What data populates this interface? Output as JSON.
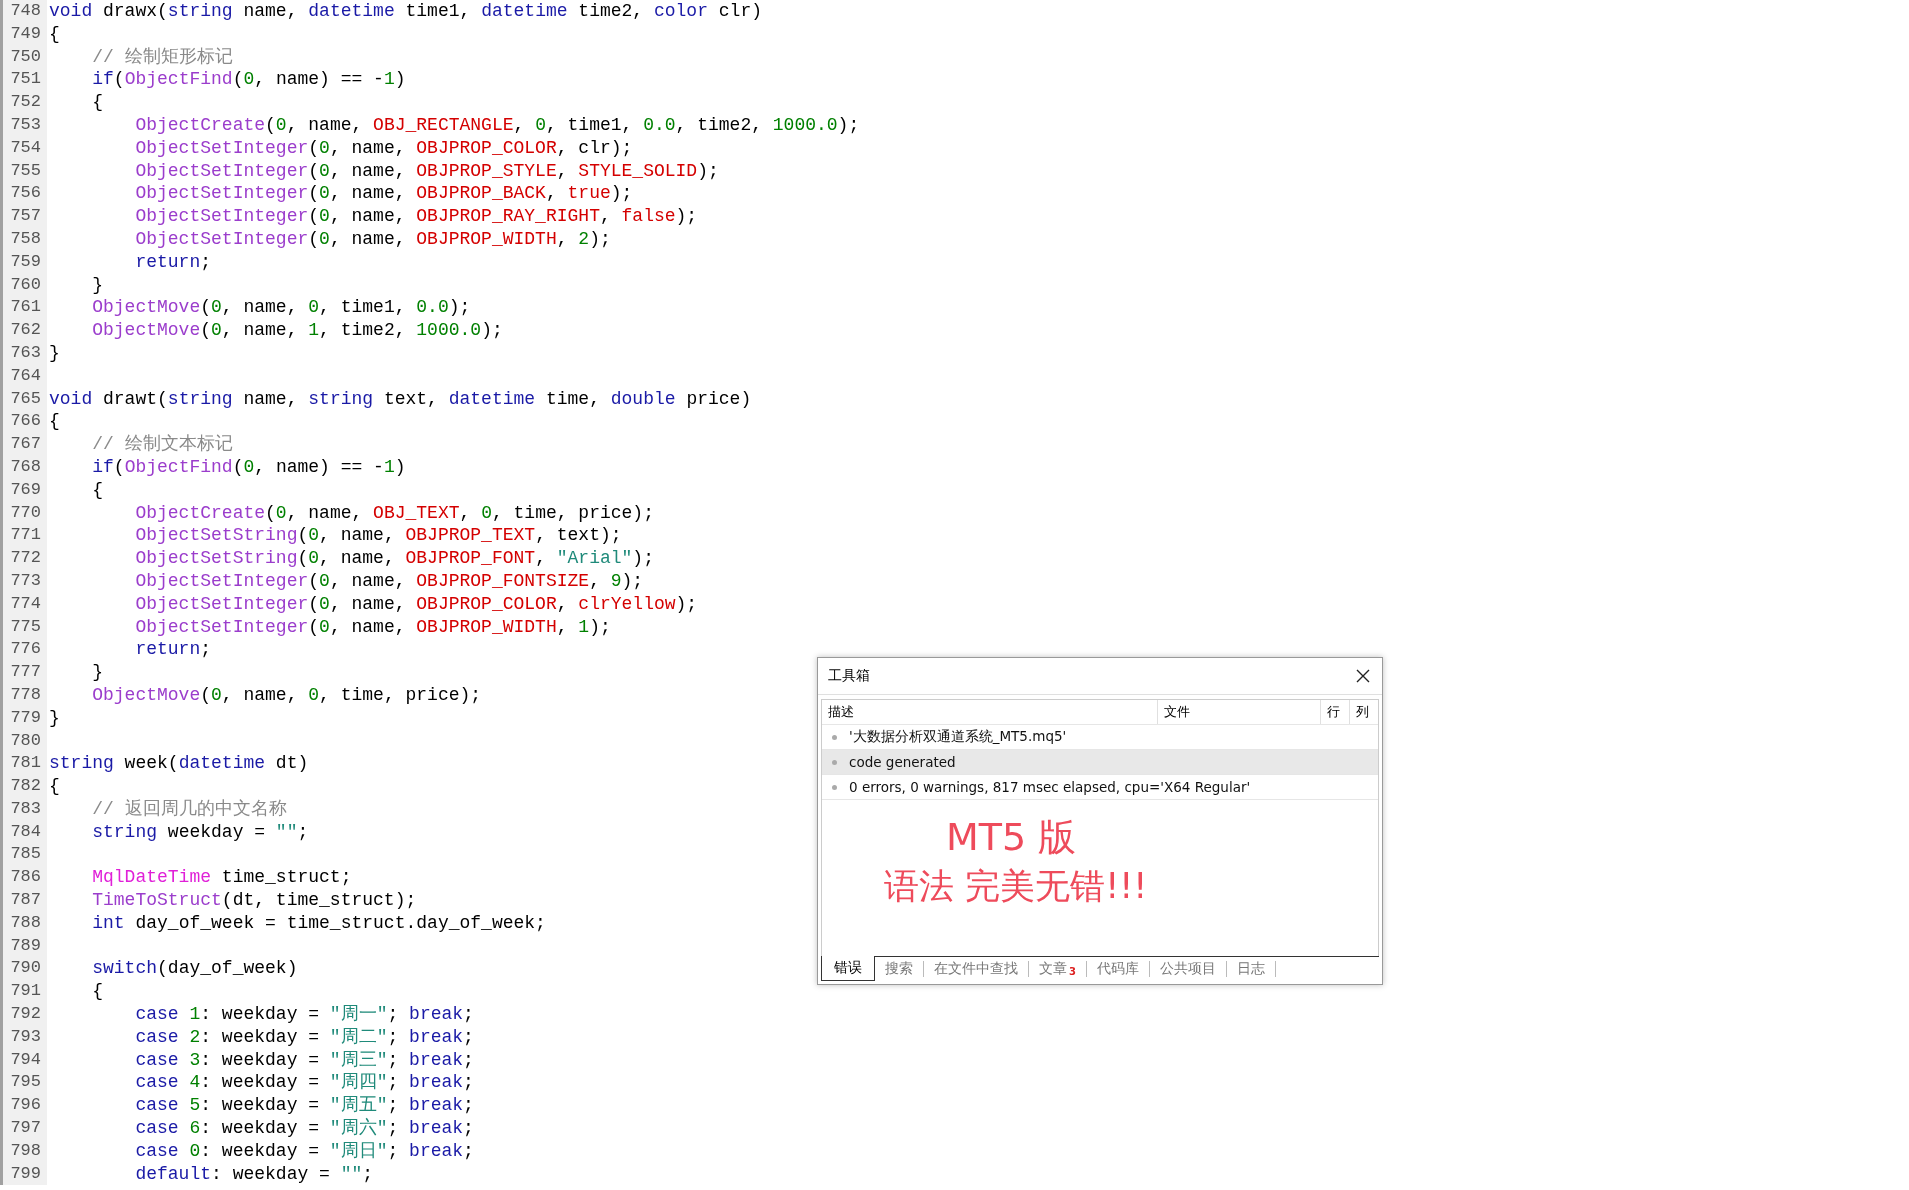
{
  "editor": {
    "lines": [
      {
        "number": "748",
        "tokens": [
          {
            "kind": "keyword",
            "text": "void"
          },
          {
            "kind": "plain",
            "text": " drawx("
          },
          {
            "kind": "keyword",
            "text": "string"
          },
          {
            "kind": "plain",
            "text": " name, "
          },
          {
            "kind": "keyword",
            "text": "datetime"
          },
          {
            "kind": "plain",
            "text": " time1, "
          },
          {
            "kind": "keyword",
            "text": "datetime"
          },
          {
            "kind": "plain",
            "text": " time2, "
          },
          {
            "kind": "keyword",
            "text": "color"
          },
          {
            "kind": "plain",
            "text": " clr)"
          }
        ]
      },
      {
        "number": "749",
        "tokens": [
          {
            "kind": "plain",
            "text": "{"
          }
        ]
      },
      {
        "number": "750",
        "tokens": [
          {
            "kind": "comment",
            "text": "    // 绘制矩形标记"
          }
        ]
      },
      {
        "number": "751",
        "tokens": [
          {
            "kind": "keyword",
            "text": "    if"
          },
          {
            "kind": "plain",
            "text": "("
          },
          {
            "kind": "function",
            "text": "ObjectFind"
          },
          {
            "kind": "plain",
            "text": "("
          },
          {
            "kind": "number",
            "text": "0"
          },
          {
            "kind": "plain",
            "text": ", name) == -"
          },
          {
            "kind": "number",
            "text": "1"
          },
          {
            "kind": "plain",
            "text": ")"
          }
        ]
      },
      {
        "number": "752",
        "tokens": [
          {
            "kind": "plain",
            "text": "    {"
          }
        ]
      },
      {
        "number": "753",
        "tokens": [
          {
            "kind": "function",
            "text": "        ObjectCreate"
          },
          {
            "kind": "plain",
            "text": "("
          },
          {
            "kind": "number",
            "text": "0"
          },
          {
            "kind": "plain",
            "text": ", name, "
          },
          {
            "kind": "constant",
            "text": "OBJ_RECTANGLE"
          },
          {
            "kind": "plain",
            "text": ", "
          },
          {
            "kind": "number",
            "text": "0"
          },
          {
            "kind": "plain",
            "text": ", time1, "
          },
          {
            "kind": "number",
            "text": "0.0"
          },
          {
            "kind": "plain",
            "text": ", time2, "
          },
          {
            "kind": "number",
            "text": "1000.0"
          },
          {
            "kind": "plain",
            "text": ");"
          }
        ]
      },
      {
        "number": "754",
        "tokens": [
          {
            "kind": "function",
            "text": "        ObjectSetInteger"
          },
          {
            "kind": "plain",
            "text": "("
          },
          {
            "kind": "number",
            "text": "0"
          },
          {
            "kind": "plain",
            "text": ", name, "
          },
          {
            "kind": "constant",
            "text": "OBJPROP_COLOR"
          },
          {
            "kind": "plain",
            "text": ", clr);"
          }
        ]
      },
      {
        "number": "755",
        "tokens": [
          {
            "kind": "function",
            "text": "        ObjectSetInteger"
          },
          {
            "kind": "plain",
            "text": "("
          },
          {
            "kind": "number",
            "text": "0"
          },
          {
            "kind": "plain",
            "text": ", name, "
          },
          {
            "kind": "constant",
            "text": "OBJPROP_STYLE"
          },
          {
            "kind": "plain",
            "text": ", "
          },
          {
            "kind": "constant",
            "text": "STYLE_SOLID"
          },
          {
            "kind": "plain",
            "text": ");"
          }
        ]
      },
      {
        "number": "756",
        "tokens": [
          {
            "kind": "function",
            "text": "        ObjectSetInteger"
          },
          {
            "kind": "plain",
            "text": "("
          },
          {
            "kind": "number",
            "text": "0"
          },
          {
            "kind": "plain",
            "text": ", name, "
          },
          {
            "kind": "constant",
            "text": "OBJPROP_BACK"
          },
          {
            "kind": "plain",
            "text": ", "
          },
          {
            "kind": "constant",
            "text": "true"
          },
          {
            "kind": "plain",
            "text": ");"
          }
        ]
      },
      {
        "number": "757",
        "tokens": [
          {
            "kind": "function",
            "text": "        ObjectSetInteger"
          },
          {
            "kind": "plain",
            "text": "("
          },
          {
            "kind": "number",
            "text": "0"
          },
          {
            "kind": "plain",
            "text": ", name, "
          },
          {
            "kind": "constant",
            "text": "OBJPROP_RAY_RIGHT"
          },
          {
            "kind": "plain",
            "text": ", "
          },
          {
            "kind": "constant",
            "text": "false"
          },
          {
            "kind": "plain",
            "text": ");"
          }
        ]
      },
      {
        "number": "758",
        "tokens": [
          {
            "kind": "function",
            "text": "        ObjectSetInteger"
          },
          {
            "kind": "plain",
            "text": "("
          },
          {
            "kind": "number",
            "text": "0"
          },
          {
            "kind": "plain",
            "text": ", name, "
          },
          {
            "kind": "constant",
            "text": "OBJPROP_WIDTH"
          },
          {
            "kind": "plain",
            "text": ", "
          },
          {
            "kind": "number",
            "text": "2"
          },
          {
            "kind": "plain",
            "text": ");"
          }
        ]
      },
      {
        "number": "759",
        "tokens": [
          {
            "kind": "keyword",
            "text": "        return"
          },
          {
            "kind": "plain",
            "text": ";"
          }
        ]
      },
      {
        "number": "760",
        "tokens": [
          {
            "kind": "plain",
            "text": "    }"
          }
        ]
      },
      {
        "number": "761",
        "tokens": [
          {
            "kind": "function",
            "text": "    ObjectMove"
          },
          {
            "kind": "plain",
            "text": "("
          },
          {
            "kind": "number",
            "text": "0"
          },
          {
            "kind": "plain",
            "text": ", name, "
          },
          {
            "kind": "number",
            "text": "0"
          },
          {
            "kind": "plain",
            "text": ", time1, "
          },
          {
            "kind": "number",
            "text": "0.0"
          },
          {
            "kind": "plain",
            "text": ");"
          }
        ]
      },
      {
        "number": "762",
        "tokens": [
          {
            "kind": "function",
            "text": "    ObjectMove"
          },
          {
            "kind": "plain",
            "text": "("
          },
          {
            "kind": "number",
            "text": "0"
          },
          {
            "kind": "plain",
            "text": ", name, "
          },
          {
            "kind": "number",
            "text": "1"
          },
          {
            "kind": "plain",
            "text": ", time2, "
          },
          {
            "kind": "number",
            "text": "1000.0"
          },
          {
            "kind": "plain",
            "text": ");"
          }
        ]
      },
      {
        "number": "763",
        "tokens": [
          {
            "kind": "plain",
            "text": "}"
          }
        ]
      },
      {
        "number": "764"
      },
      {
        "number": "765",
        "tokens": [
          {
            "kind": "keyword",
            "text": "void"
          },
          {
            "kind": "plain",
            "text": " drawt("
          },
          {
            "kind": "keyword",
            "text": "string"
          },
          {
            "kind": "plain",
            "text": " name, "
          },
          {
            "kind": "keyword",
            "text": "string"
          },
          {
            "kind": "plain",
            "text": " text, "
          },
          {
            "kind": "keyword",
            "text": "datetime"
          },
          {
            "kind": "plain",
            "text": " time, "
          },
          {
            "kind": "keyword",
            "text": "double"
          },
          {
            "kind": "plain",
            "text": " price)"
          }
        ]
      },
      {
        "number": "766",
        "tokens": [
          {
            "kind": "plain",
            "text": "{"
          }
        ]
      },
      {
        "number": "767",
        "tokens": [
          {
            "kind": "comment",
            "text": "    // 绘制文本标记"
          }
        ]
      },
      {
        "number": "768",
        "tokens": [
          {
            "kind": "keyword",
            "text": "    if"
          },
          {
            "kind": "plain",
            "text": "("
          },
          {
            "kind": "function",
            "text": "ObjectFind"
          },
          {
            "kind": "plain",
            "text": "("
          },
          {
            "kind": "number",
            "text": "0"
          },
          {
            "kind": "plain",
            "text": ", name) == -"
          },
          {
            "kind": "number",
            "text": "1"
          },
          {
            "kind": "plain",
            "text": ")"
          }
        ]
      },
      {
        "number": "769",
        "tokens": [
          {
            "kind": "plain",
            "text": "    {"
          }
        ]
      },
      {
        "number": "770",
        "tokens": [
          {
            "kind": "function",
            "text": "        ObjectCreate"
          },
          {
            "kind": "plain",
            "text": "("
          },
          {
            "kind": "number",
            "text": "0"
          },
          {
            "kind": "plain",
            "text": ", name, "
          },
          {
            "kind": "constant",
            "text": "OBJ_TEXT"
          },
          {
            "kind": "plain",
            "text": ", "
          },
          {
            "kind": "number",
            "text": "0"
          },
          {
            "kind": "plain",
            "text": ", time, price);"
          }
        ]
      },
      {
        "number": "771",
        "tokens": [
          {
            "kind": "function",
            "text": "        ObjectSetString"
          },
          {
            "kind": "plain",
            "text": "("
          },
          {
            "kind": "number",
            "text": "0"
          },
          {
            "kind": "plain",
            "text": ", name, "
          },
          {
            "kind": "constant",
            "text": "OBJPROP_TEXT"
          },
          {
            "kind": "plain",
            "text": ", text);"
          }
        ]
      },
      {
        "number": "772",
        "tokens": [
          {
            "kind": "function",
            "text": "        ObjectSetString"
          },
          {
            "kind": "plain",
            "text": "("
          },
          {
            "kind": "number",
            "text": "0"
          },
          {
            "kind": "plain",
            "text": ", name, "
          },
          {
            "kind": "constant",
            "text": "OBJPROP_FONT"
          },
          {
            "kind": "plain",
            "text": ", "
          },
          {
            "kind": "string",
            "text": "\"Arial\""
          },
          {
            "kind": "plain",
            "text": ");"
          }
        ]
      },
      {
        "number": "773",
        "tokens": [
          {
            "kind": "function",
            "text": "        ObjectSetInteger"
          },
          {
            "kind": "plain",
            "text": "("
          },
          {
            "kind": "number",
            "text": "0"
          },
          {
            "kind": "plain",
            "text": ", name, "
          },
          {
            "kind": "constant",
            "text": "OBJPROP_FONTSIZE"
          },
          {
            "kind": "plain",
            "text": ", "
          },
          {
            "kind": "number",
            "text": "9"
          },
          {
            "kind": "plain",
            "text": ");"
          }
        ]
      },
      {
        "number": "774",
        "tokens": [
          {
            "kind": "function",
            "text": "        ObjectSetInteger"
          },
          {
            "kind": "plain",
            "text": "("
          },
          {
            "kind": "number",
            "text": "0"
          },
          {
            "kind": "plain",
            "text": ", name, "
          },
          {
            "kind": "constant",
            "text": "OBJPROP_COLOR"
          },
          {
            "kind": "plain",
            "text": ", "
          },
          {
            "kind": "constant",
            "text": "clrYellow"
          },
          {
            "kind": "plain",
            "text": ");"
          }
        ]
      },
      {
        "number": "775",
        "tokens": [
          {
            "kind": "function",
            "text": "        ObjectSetInteger"
          },
          {
            "kind": "plain",
            "text": "("
          },
          {
            "kind": "number",
            "text": "0"
          },
          {
            "kind": "plain",
            "text": ", name, "
          },
          {
            "kind": "constant",
            "text": "OBJPROP_WIDTH"
          },
          {
            "kind": "plain",
            "text": ", "
          },
          {
            "kind": "number",
            "text": "1"
          },
          {
            "kind": "plain",
            "text": ");"
          }
        ]
      },
      {
        "number": "776",
        "tokens": [
          {
            "kind": "keyword",
            "text": "        return"
          },
          {
            "kind": "plain",
            "text": ";"
          }
        ]
      },
      {
        "number": "777",
        "tokens": [
          {
            "kind": "plain",
            "text": "    }"
          }
        ]
      },
      {
        "number": "778",
        "tokens": [
          {
            "kind": "function",
            "text": "    ObjectMove"
          },
          {
            "kind": "plain",
            "text": "("
          },
          {
            "kind": "number",
            "text": "0"
          },
          {
            "kind": "plain",
            "text": ", name, "
          },
          {
            "kind": "number",
            "text": "0"
          },
          {
            "kind": "plain",
            "text": ", time, price);"
          }
        ]
      },
      {
        "number": "779",
        "tokens": [
          {
            "kind": "plain",
            "text": "}"
          }
        ]
      },
      {
        "number": "780"
      },
      {
        "number": "781",
        "tokens": [
          {
            "kind": "keyword",
            "text": "string"
          },
          {
            "kind": "plain",
            "text": " week("
          },
          {
            "kind": "keyword",
            "text": "datetime"
          },
          {
            "kind": "plain",
            "text": " dt)"
          }
        ]
      },
      {
        "number": "782",
        "tokens": [
          {
            "kind": "plain",
            "text": "{"
          }
        ]
      },
      {
        "number": "783",
        "tokens": [
          {
            "kind": "comment",
            "text": "    // 返回周几的中文名称"
          }
        ]
      },
      {
        "number": "784",
        "tokens": [
          {
            "kind": "keyword",
            "text": "    string"
          },
          {
            "kind": "plain",
            "text": " weekday = "
          },
          {
            "kind": "string",
            "text": "\"\""
          },
          {
            "kind": "plain",
            "text": ";"
          }
        ]
      },
      {
        "number": "785"
      },
      {
        "number": "786",
        "tokens": [
          {
            "kind": "type",
            "text": "    MqlDateTime"
          },
          {
            "kind": "plain",
            "text": " time_struct;"
          }
        ]
      },
      {
        "number": "787",
        "tokens": [
          {
            "kind": "function",
            "text": "    TimeToStruct"
          },
          {
            "kind": "plain",
            "text": "(dt, time_struct);"
          }
        ]
      },
      {
        "number": "788",
        "tokens": [
          {
            "kind": "keyword",
            "text": "    int"
          },
          {
            "kind": "plain",
            "text": " day_of_week = time_struct.day_of_week;"
          }
        ]
      },
      {
        "number": "789"
      },
      {
        "number": "790",
        "tokens": [
          {
            "kind": "keyword",
            "text": "    switch"
          },
          {
            "kind": "plain",
            "text": "(day_of_week)"
          }
        ]
      },
      {
        "number": "791",
        "tokens": [
          {
            "kind": "plain",
            "text": "    {"
          }
        ]
      },
      {
        "number": "792",
        "tokens": [
          {
            "kind": "keyword",
            "text": "        case"
          },
          {
            "kind": "number",
            "text": " 1"
          },
          {
            "kind": "plain",
            "text": ": weekday = "
          },
          {
            "kind": "string",
            "text": "\"周一\""
          },
          {
            "kind": "plain",
            "text": "; "
          },
          {
            "kind": "keyword",
            "text": "break"
          },
          {
            "kind": "plain",
            "text": ";"
          }
        ]
      },
      {
        "number": "793",
        "tokens": [
          {
            "kind": "keyword",
            "text": "        case"
          },
          {
            "kind": "number",
            "text": " 2"
          },
          {
            "kind": "plain",
            "text": ": weekday = "
          },
          {
            "kind": "string",
            "text": "\"周二\""
          },
          {
            "kind": "plain",
            "text": "; "
          },
          {
            "kind": "keyword",
            "text": "break"
          },
          {
            "kind": "plain",
            "text": ";"
          }
        ]
      },
      {
        "number": "794",
        "tokens": [
          {
            "kind": "keyword",
            "text": "        case"
          },
          {
            "kind": "number",
            "text": " 3"
          },
          {
            "kind": "plain",
            "text": ": weekday = "
          },
          {
            "kind": "string",
            "text": "\"周三\""
          },
          {
            "kind": "plain",
            "text": "; "
          },
          {
            "kind": "keyword",
            "text": "break"
          },
          {
            "kind": "plain",
            "text": ";"
          }
        ]
      },
      {
        "number": "795",
        "tokens": [
          {
            "kind": "keyword",
            "text": "        case"
          },
          {
            "kind": "number",
            "text": " 4"
          },
          {
            "kind": "plain",
            "text": ": weekday = "
          },
          {
            "kind": "string",
            "text": "\"周四\""
          },
          {
            "kind": "plain",
            "text": "; "
          },
          {
            "kind": "keyword",
            "text": "break"
          },
          {
            "kind": "plain",
            "text": ";"
          }
        ]
      },
      {
        "number": "796",
        "tokens": [
          {
            "kind": "keyword",
            "text": "        case"
          },
          {
            "kind": "number",
            "text": " 5"
          },
          {
            "kind": "plain",
            "text": ": weekday = "
          },
          {
            "kind": "string",
            "text": "\"周五\""
          },
          {
            "kind": "plain",
            "text": "; "
          },
          {
            "kind": "keyword",
            "text": "break"
          },
          {
            "kind": "plain",
            "text": ";"
          }
        ]
      },
      {
        "number": "797",
        "tokens": [
          {
            "kind": "keyword",
            "text": "        case"
          },
          {
            "kind": "number",
            "text": " 6"
          },
          {
            "kind": "plain",
            "text": ": weekday = "
          },
          {
            "kind": "string",
            "text": "\"周六\""
          },
          {
            "kind": "plain",
            "text": "; "
          },
          {
            "kind": "keyword",
            "text": "break"
          },
          {
            "kind": "plain",
            "text": ";"
          }
        ]
      },
      {
        "number": "798",
        "tokens": [
          {
            "kind": "keyword",
            "text": "        case"
          },
          {
            "kind": "number",
            "text": " 0"
          },
          {
            "kind": "plain",
            "text": ": weekday = "
          },
          {
            "kind": "string",
            "text": "\"周日\""
          },
          {
            "kind": "plain",
            "text": "; "
          },
          {
            "kind": "keyword",
            "text": "break"
          },
          {
            "kind": "plain",
            "text": ";"
          }
        ]
      },
      {
        "number": "799",
        "tokens": [
          {
            "kind": "keyword",
            "text": "        default"
          },
          {
            "kind": "plain",
            "text": ": weekday = "
          },
          {
            "kind": "string",
            "text": "\"\""
          },
          {
            "kind": "plain",
            "text": ";"
          }
        ]
      }
    ]
  },
  "toolbox": {
    "title": "工具箱",
    "columns": [
      "描述",
      "文件",
      "行",
      "列"
    ],
    "messages": [
      {
        "text": "'大数据分析双通道系统_MT5.mq5'",
        "selected": false
      },
      {
        "text": "code generated",
        "selected": true
      },
      {
        "text": "0 errors, 0 warnings, 817 msec elapsed, cpu='X64 Regular'",
        "selected": false
      }
    ],
    "annotation": [
      "MT5 版",
      "语法 完美无错!!!"
    ],
    "tabs": [
      {
        "label": "错误",
        "selected": true
      },
      {
        "label": "搜索",
        "selected": false
      },
      {
        "label": "在文件中查找",
        "selected": false
      },
      {
        "label": "文章",
        "badge": "3",
        "selected": false
      },
      {
        "label": "代码库",
        "selected": false
      },
      {
        "label": "公共项目",
        "selected": false
      },
      {
        "label": "日志",
        "selected": false
      }
    ]
  }
}
